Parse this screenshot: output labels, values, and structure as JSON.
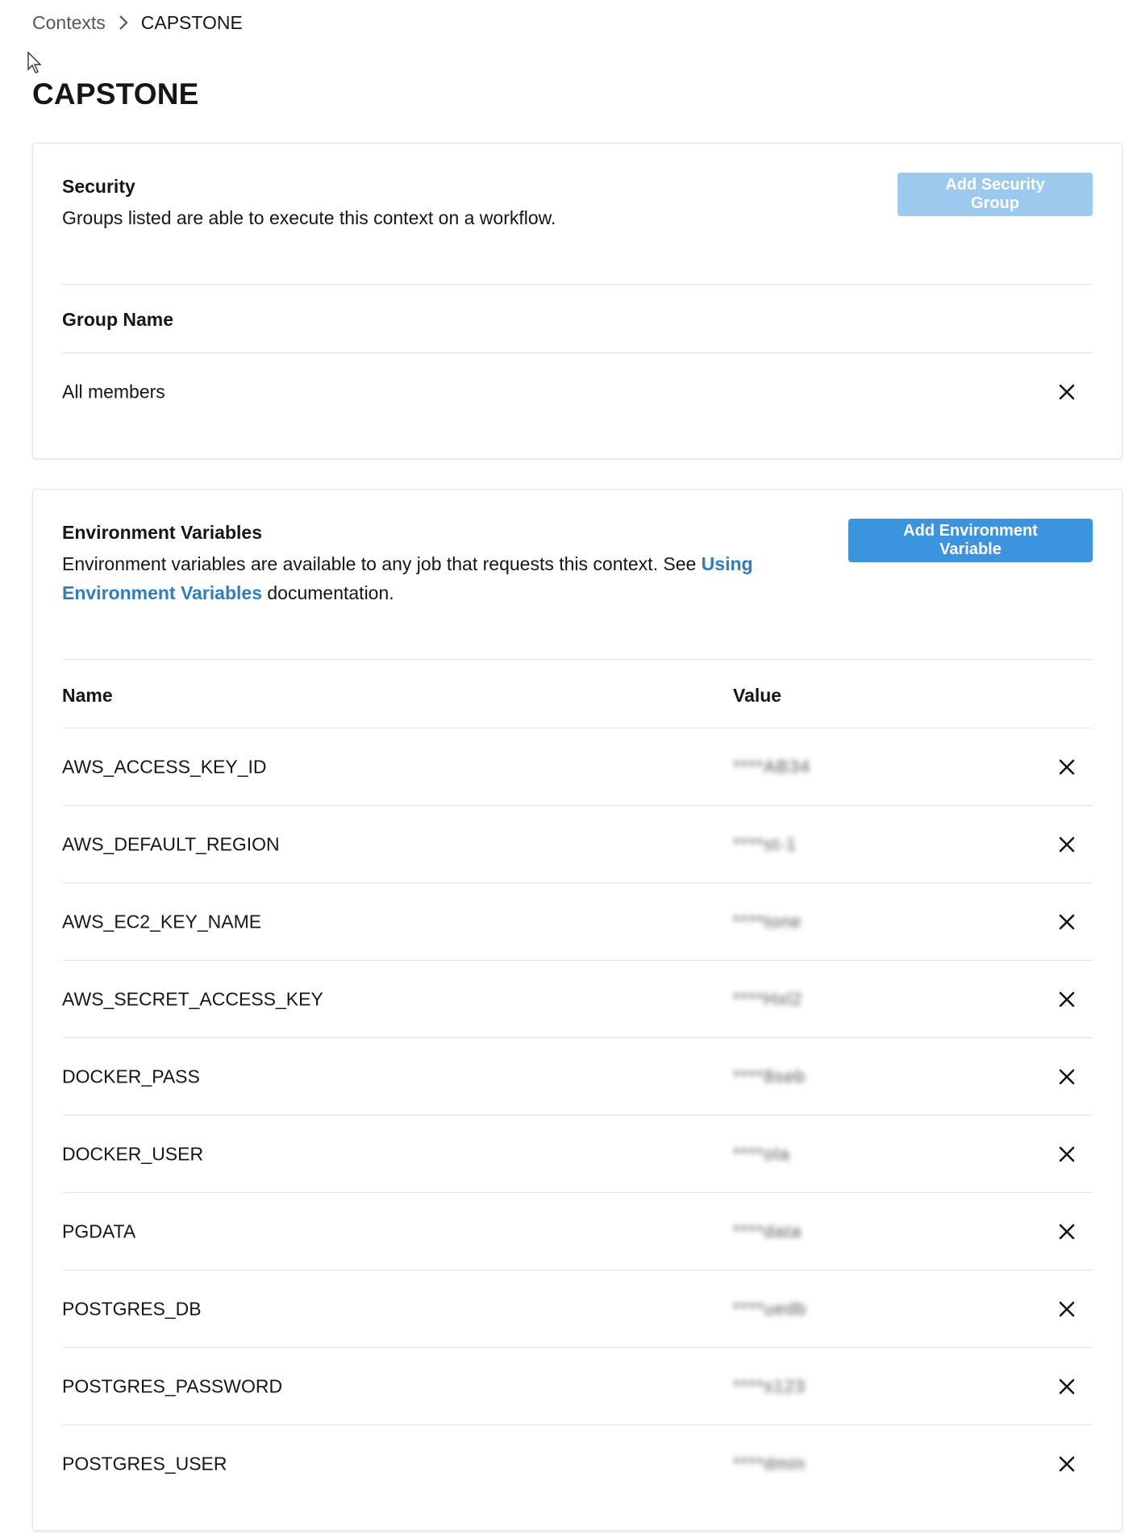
{
  "breadcrumb": {
    "root": "Contexts",
    "current": "CAPSTONE"
  },
  "page": {
    "title": "CAPSTONE"
  },
  "security": {
    "title": "Security",
    "description": "Groups listed are able to execute this context on a workflow.",
    "add_button": "Add Security Group",
    "add_button_state": "disabled",
    "column_header": "Group Name",
    "groups": [
      {
        "name": "All members"
      }
    ]
  },
  "env": {
    "title": "Environment Variables",
    "description_before": "Environment variables are available to any job that requests this context. See ",
    "link_text_1": "Using",
    "link_text_2": "Environment Variables",
    "description_after": " documentation.",
    "add_button": "Add Environment Variable",
    "column_name": "Name",
    "column_value": "Value",
    "variables": [
      {
        "name": "AWS_ACCESS_KEY_ID",
        "value": "****AB34"
      },
      {
        "name": "AWS_DEFAULT_REGION",
        "value": "****st-1"
      },
      {
        "name": "AWS_EC2_KEY_NAME",
        "value": "****tone"
      },
      {
        "name": "AWS_SECRET_ACCESS_KEY",
        "value": "****Hxl2"
      },
      {
        "name": "DOCKER_PASS",
        "value": "****8seb"
      },
      {
        "name": "DOCKER_USER",
        "value": "****ola"
      },
      {
        "name": "PGDATA",
        "value": "****data"
      },
      {
        "name": "POSTGRES_DB",
        "value": "****uedb"
      },
      {
        "name": "POSTGRES_PASSWORD",
        "value": "****s123"
      },
      {
        "name": "POSTGRES_USER",
        "value": "****dmin"
      }
    ]
  },
  "colors": {
    "primary": "#3b94dd",
    "primary_disabled": "#9ccaef",
    "link": "#2d7ec1",
    "border": "#e3e3e3",
    "text": "#161616"
  }
}
